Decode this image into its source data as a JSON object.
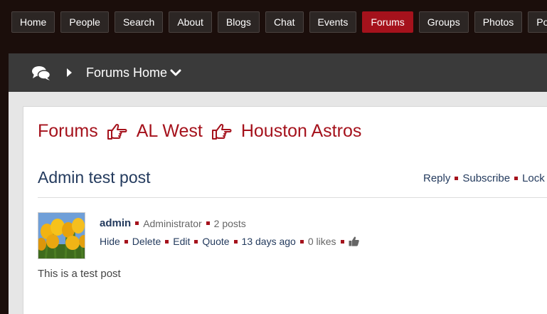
{
  "nav": {
    "items": [
      "Home",
      "People",
      "Search",
      "About",
      "Blogs",
      "Chat",
      "Events",
      "Forums",
      "Groups",
      "Photos",
      "Polls"
    ],
    "active_index": 7
  },
  "header_bar": {
    "icons": [
      "chat-bubbles-icon",
      "caret-right-icon",
      "chevron-down-icon"
    ],
    "forums_home_label": "Forums Home"
  },
  "breadcrumb": {
    "items": [
      "Forums",
      "AL West",
      "Houston Astros"
    ],
    "separator_icon": "hand-point-right-icon"
  },
  "topic": {
    "title": "Admin test post",
    "actions": [
      "Reply",
      "Subscribe",
      "Lock"
    ]
  },
  "post": {
    "author": "admin",
    "role": "Administrator",
    "post_count": "2 posts",
    "actions": [
      "Hide",
      "Delete",
      "Edit",
      "Quote"
    ],
    "time_ago": "13 days ago",
    "likes": "0 likes",
    "like_icon": "thumbs-up-icon",
    "body": "This is a test post"
  },
  "colors": {
    "accent": "#a5121c",
    "link": "#243b5e",
    "page_bg": "#1b0e0b",
    "bar_bg": "#3a3a3a"
  }
}
